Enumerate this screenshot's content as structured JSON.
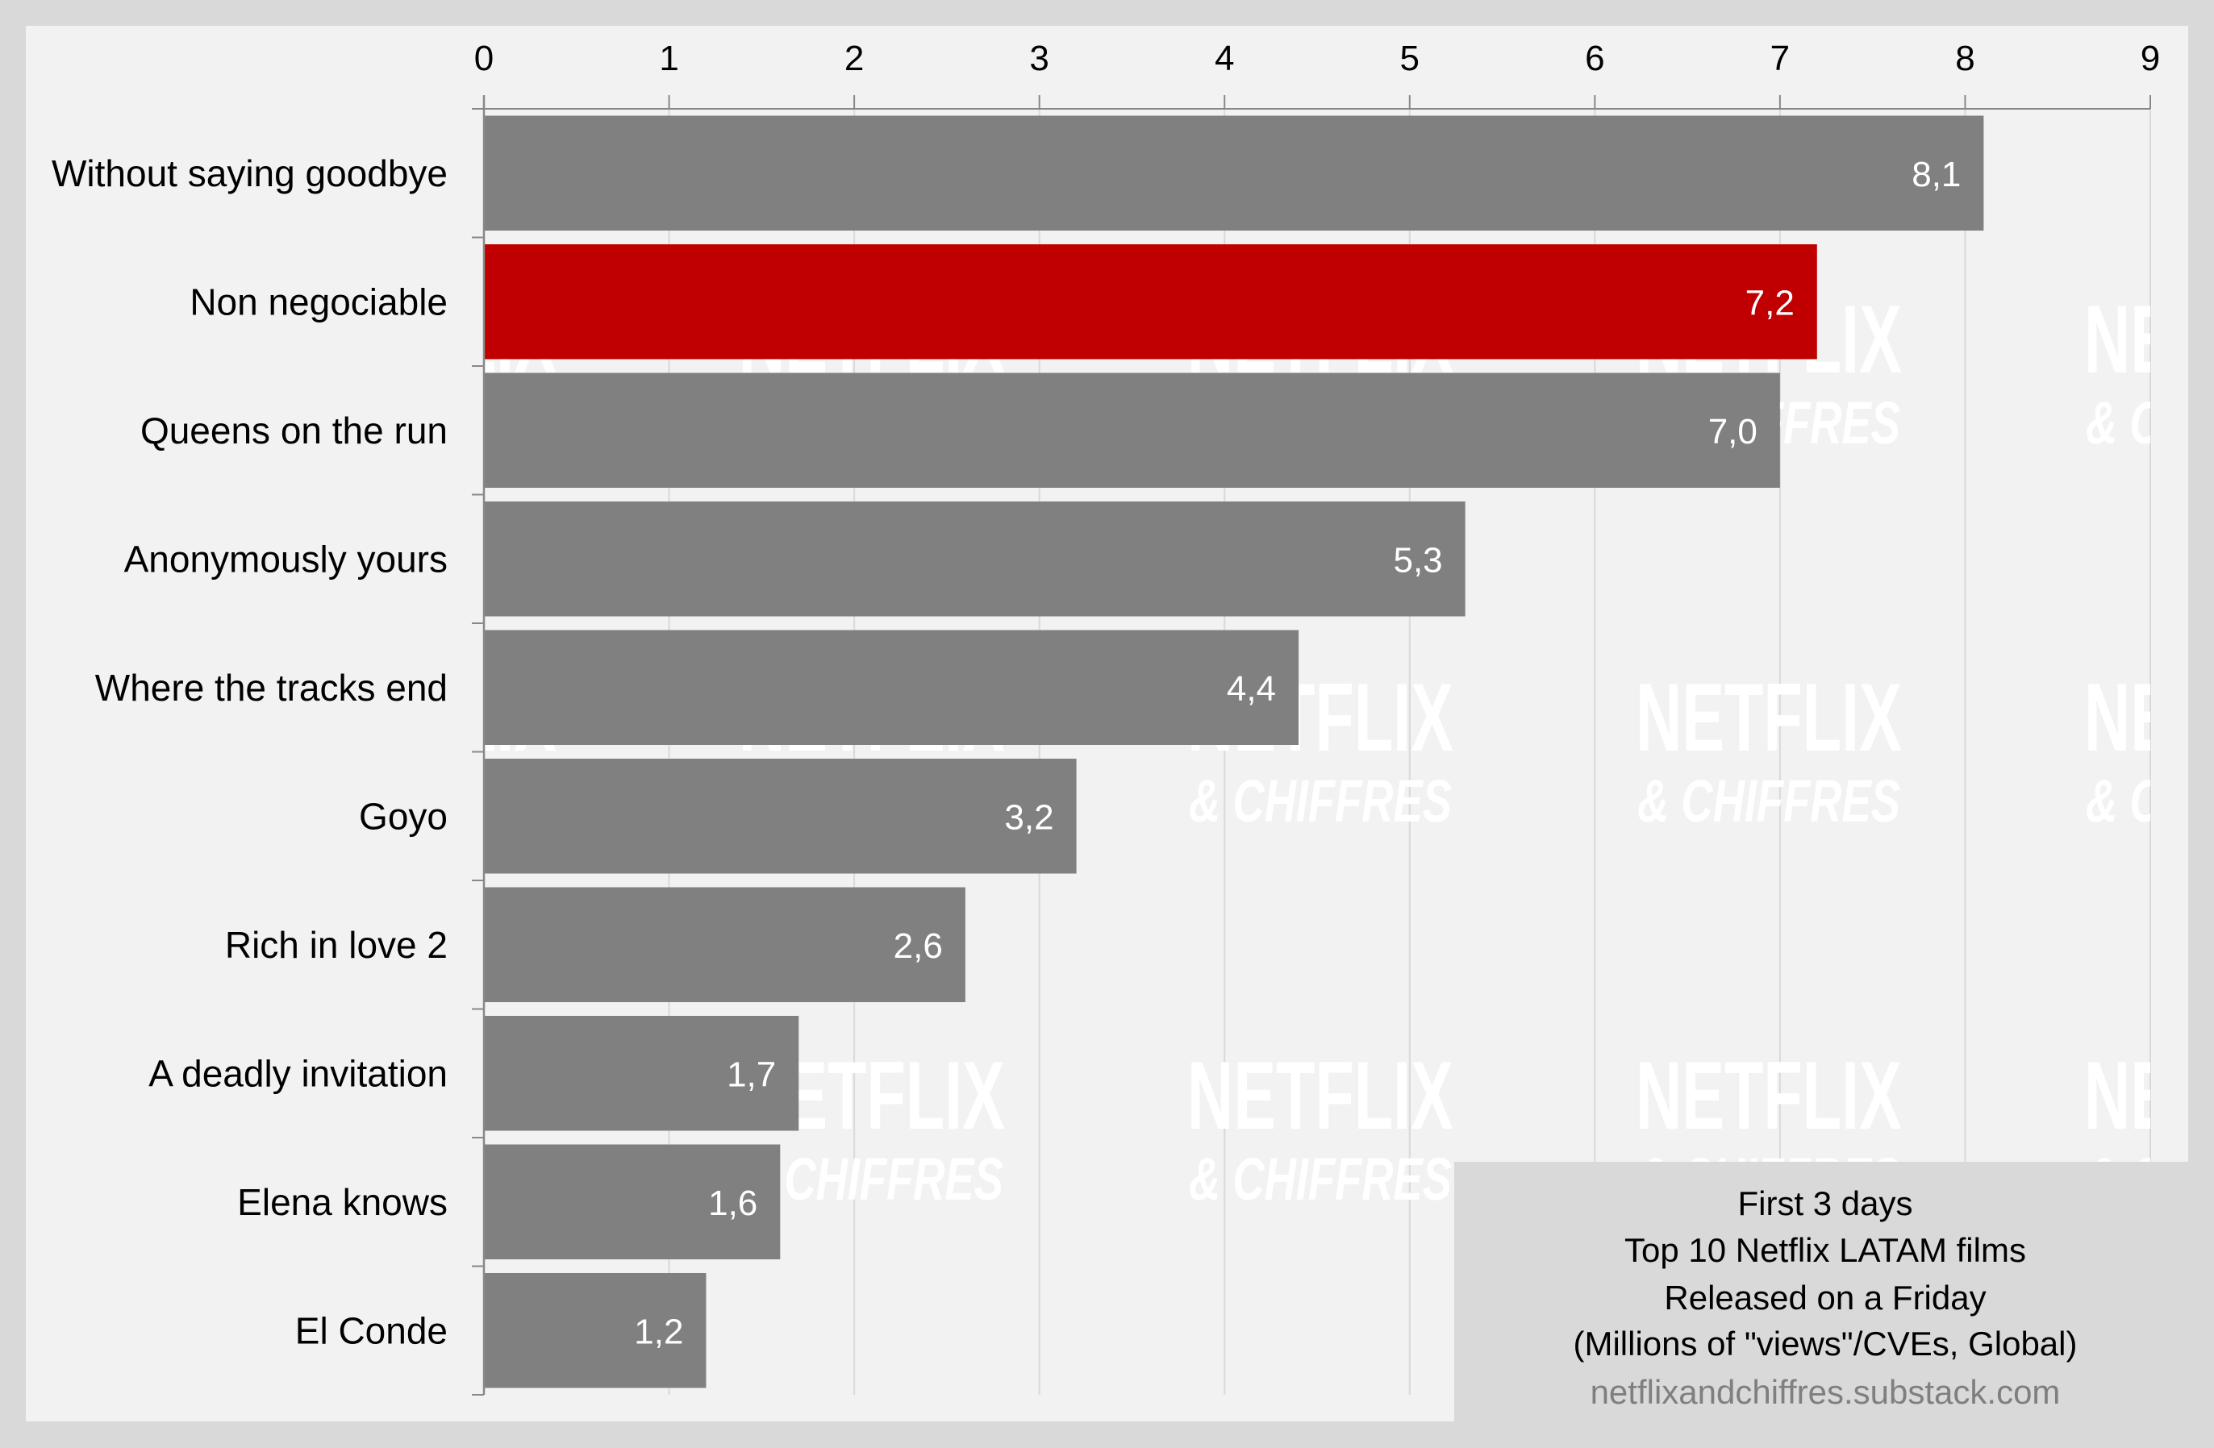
{
  "chart_data": {
    "type": "bar",
    "orientation": "horizontal",
    "categories": [
      "Without saying goodbye",
      "Non negociable",
      "Queens on the run",
      "Anonymously yours",
      "Where the tracks end",
      "Goyo",
      "Rich in love 2",
      "A deadly invitation",
      "Elena knows",
      "El Conde"
    ],
    "values": [
      8.1,
      7.2,
      7.0,
      5.3,
      4.4,
      3.2,
      2.6,
      1.7,
      1.6,
      1.2
    ],
    "value_labels": [
      "8,1",
      "7,2",
      "7,0",
      "5,3",
      "4,4",
      "3,2",
      "2,6",
      "1,7",
      "1,6",
      "1,2"
    ],
    "highlight_index": 1,
    "xlim": [
      0,
      9
    ],
    "x_ticks": [
      0,
      1,
      2,
      3,
      4,
      5,
      6,
      7,
      8,
      9
    ],
    "x_axis_position": "top",
    "grid": true,
    "xlabel": "",
    "ylabel": "",
    "title": "First 3 days Top 10 Netflix LATAM films Released on a Friday",
    "subtitle": "(Millions of \"views\"/CVEs, Global)",
    "colors": {
      "bar": "#808080",
      "highlight": "#c00000",
      "value_label": "#ffffff",
      "axis": "#888888",
      "grid": "#d9d9d9"
    },
    "watermark": {
      "line1": "NETFLIX",
      "line2": "& CHIFFRES",
      "color": "#ffffff"
    }
  },
  "caption": {
    "lines": [
      "First 3 days",
      "Top 10 Netflix LATAM films",
      "Released on a Friday",
      "(Millions of \"views\"/CVEs, Global)"
    ],
    "source": "netflixandchiffres.substack.com"
  },
  "colors": {
    "page_background": "#d9d9d9",
    "panel_background": "#f2f2f2",
    "source_text": "#7f7f7f"
  }
}
